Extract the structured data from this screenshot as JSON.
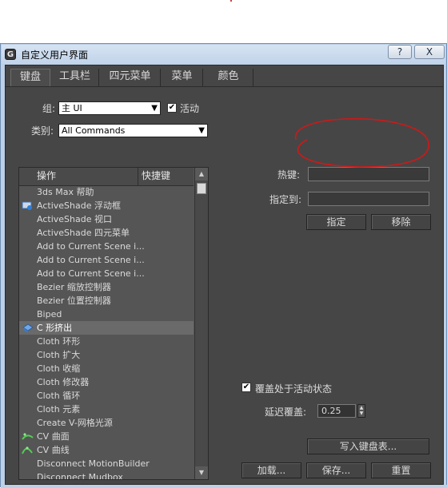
{
  "window": {
    "title": "自定义用户界面",
    "help_label": "?",
    "close_label": "X",
    "app_icon": "3ds-max-logo-icon"
  },
  "tabs": [
    {
      "label": "键盘",
      "active": true
    },
    {
      "label": "工具栏",
      "active": false
    },
    {
      "label": "四元菜单",
      "active": false
    },
    {
      "label": "菜单",
      "active": false
    },
    {
      "label": "颜色",
      "active": false
    }
  ],
  "group": {
    "label": "组:",
    "value": "主 UI"
  },
  "active_checkbox": {
    "label": "活动",
    "checked": true
  },
  "category": {
    "label": "类别:",
    "value": "All Commands"
  },
  "list": {
    "col_action": "操作",
    "col_shortcut": "快捷键",
    "rows": [
      {
        "label": "3ds Max 帮助",
        "icon": null,
        "selected": false
      },
      {
        "label": "ActiveShade 浮动框",
        "icon": "activeshade-icon",
        "selected": false
      },
      {
        "label": "ActiveShade 视口",
        "icon": null,
        "selected": false
      },
      {
        "label": "ActiveShade 四元菜单",
        "icon": null,
        "selected": false
      },
      {
        "label": "Add to Current Scene i...",
        "icon": null,
        "selected": false
      },
      {
        "label": "Add to Current Scene i...",
        "icon": null,
        "selected": false
      },
      {
        "label": "Add to Current Scene i...",
        "icon": null,
        "selected": false
      },
      {
        "label": "Bezier 缩放控制器",
        "icon": null,
        "selected": false
      },
      {
        "label": "Bezier 位置控制器",
        "icon": null,
        "selected": false
      },
      {
        "label": "Biped",
        "icon": null,
        "selected": false
      },
      {
        "label": "C 形挤出",
        "icon": "c-extrude-icon",
        "selected": true
      },
      {
        "label": "Cloth 环形",
        "icon": null,
        "selected": false
      },
      {
        "label": "Cloth 扩大",
        "icon": null,
        "selected": false
      },
      {
        "label": "Cloth 收缩",
        "icon": null,
        "selected": false
      },
      {
        "label": "Cloth 修改器",
        "icon": null,
        "selected": false
      },
      {
        "label": "Cloth 循环",
        "icon": null,
        "selected": false
      },
      {
        "label": "Cloth 元素",
        "icon": null,
        "selected": false
      },
      {
        "label": "Create V-网格光源",
        "icon": null,
        "selected": false
      },
      {
        "label": "CV 曲面",
        "icon": "cv-surface-icon",
        "selected": false
      },
      {
        "label": "CV 曲线",
        "icon": "cv-curve-icon",
        "selected": false
      },
      {
        "label": "Disconnect MotionBuilder",
        "icon": null,
        "selected": false
      },
      {
        "label": "Disconnect Mudbox",
        "icon": null,
        "selected": false
      }
    ]
  },
  "hotkey": {
    "label": "热键:",
    "value": ""
  },
  "assigned_to": {
    "label": "指定到:",
    "value": ""
  },
  "buttons": {
    "assign": "指定",
    "remove": "移除",
    "write_keyboard": "写入键盘表...",
    "load": "加载...",
    "save": "保存...",
    "reset": "重置"
  },
  "override_checkbox": {
    "label": "覆盖处于活动状态",
    "checked": true
  },
  "delay_override": {
    "label": "延迟覆盖:",
    "value": "0.25"
  },
  "colors": {
    "annotation_circle": "#d01818",
    "panel_bg": "#464646",
    "frame": "#bcd0e6"
  }
}
